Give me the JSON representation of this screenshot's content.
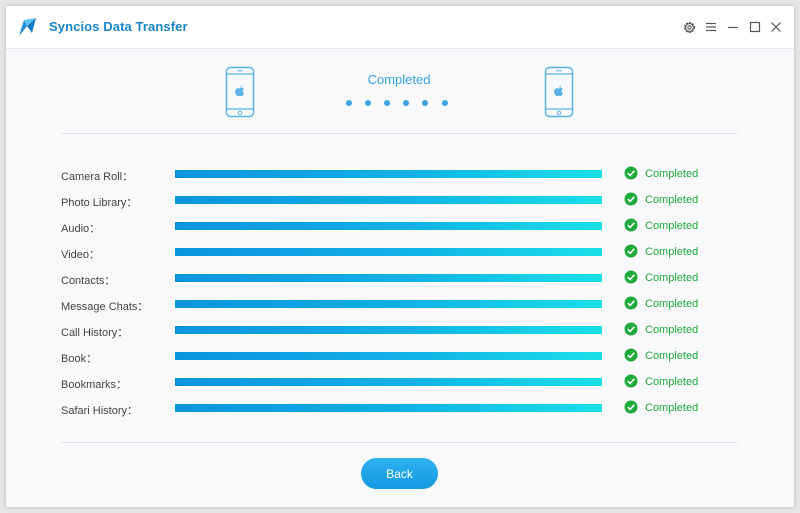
{
  "window": {
    "title": "Syncios Data Transfer",
    "icons": [
      "app-logo-icon",
      "gear-icon",
      "menu-icon",
      "minimize-icon",
      "maximize-icon",
      "close-icon"
    ]
  },
  "header": {
    "status": "Completed",
    "source_device_icon": "iphone-apple-icon",
    "target_device_icon": "iphone-apple-icon"
  },
  "items": [
    {
      "label": "Camera Roll：",
      "progress": 1.0,
      "status": "Completed"
    },
    {
      "label": "Photo Library：",
      "progress": 1.0,
      "status": "Completed"
    },
    {
      "label": "Audio：",
      "progress": 1.0,
      "status": "Completed"
    },
    {
      "label": "Video：",
      "progress": 1.0,
      "status": "Completed"
    },
    {
      "label": "Contacts：",
      "progress": 1.0,
      "status": "Completed"
    },
    {
      "label": "Message Chats：",
      "progress": 1.0,
      "status": "Completed"
    },
    {
      "label": "Call History：",
      "progress": 1.0,
      "status": "Completed"
    },
    {
      "label": "Book：",
      "progress": 1.0,
      "status": "Completed"
    },
    {
      "label": "Bookmarks：",
      "progress": 1.0,
      "status": "Completed"
    },
    {
      "label": "Safari History：",
      "progress": 1.0,
      "status": "Completed"
    }
  ],
  "footer": {
    "back_label": "Back"
  },
  "colors": {
    "accent": "#1886c9",
    "progress_start": "#0a93dd",
    "progress_end": "#19dfe6",
    "success": "#1faa3b",
    "button": "#1fa3e6"
  }
}
